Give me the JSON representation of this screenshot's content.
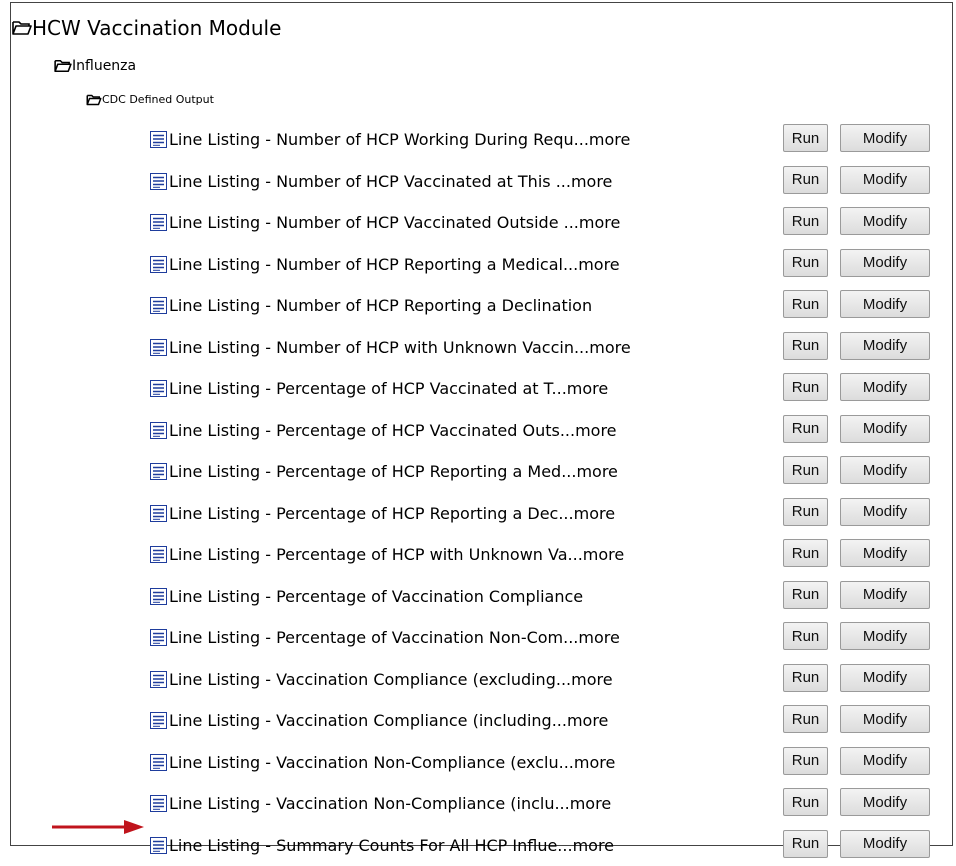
{
  "tree": {
    "module_label": "HCW Vaccination Module",
    "subfolder_label": "Influenza",
    "output_folder_label": "CDC Defined Output"
  },
  "reports": [
    {
      "title": "Line Listing - Number of HCP Working During Requ...",
      "more": "more",
      "run_label": "Run",
      "modify_label": "Modify"
    },
    {
      "title": "Line Listing - Number of HCP Vaccinated at This ...",
      "more": "more",
      "run_label": "Run",
      "modify_label": "Modify"
    },
    {
      "title": "Line Listing - Number of HCP Vaccinated Outside ...",
      "more": "more",
      "run_label": "Run",
      "modify_label": "Modify"
    },
    {
      "title": "Line Listing - Number of HCP Reporting a Medical...",
      "more": "more",
      "run_label": "Run",
      "modify_label": "Modify"
    },
    {
      "title": "Line Listing - Number of HCP Reporting a Declination",
      "more": "",
      "run_label": "Run",
      "modify_label": "Modify"
    },
    {
      "title": "Line Listing - Number of HCP with Unknown Vaccin...",
      "more": "more",
      "run_label": "Run",
      "modify_label": "Modify"
    },
    {
      "title": "Line Listing - Percentage of HCP Vaccinated at T...",
      "more": "more",
      "run_label": "Run",
      "modify_label": "Modify"
    },
    {
      "title": "Line Listing - Percentage of HCP Vaccinated Outs...",
      "more": "more",
      "run_label": "Run",
      "modify_label": "Modify"
    },
    {
      "title": "Line Listing - Percentage of HCP Reporting a Med...",
      "more": "more",
      "run_label": "Run",
      "modify_label": "Modify"
    },
    {
      "title": "Line Listing - Percentage of HCP Reporting a Dec...",
      "more": "more",
      "run_label": "Run",
      "modify_label": "Modify"
    },
    {
      "title": "Line Listing - Percentage of HCP with Unknown Va...",
      "more": "more",
      "run_label": "Run",
      "modify_label": "Modify"
    },
    {
      "title": "Line Listing - Percentage of Vaccination Compliance",
      "more": "",
      "run_label": "Run",
      "modify_label": "Modify"
    },
    {
      "title": "Line Listing - Percentage of Vaccination Non-Com...",
      "more": "more",
      "run_label": "Run",
      "modify_label": "Modify"
    },
    {
      "title": "Line Listing - Vaccination Compliance (excluding...",
      "more": "more",
      "run_label": "Run",
      "modify_label": "Modify"
    },
    {
      "title": "Line Listing - Vaccination Compliance (including...",
      "more": "more",
      "run_label": "Run",
      "modify_label": "Modify"
    },
    {
      "title": "Line Listing - Vaccination Non-Compliance (exclu...",
      "more": "more",
      "run_label": "Run",
      "modify_label": "Modify"
    },
    {
      "title": "Line Listing - Vaccination Non-Compliance (inclu...",
      "more": "more",
      "run_label": "Run",
      "modify_label": "Modify"
    },
    {
      "title": "Line Listing - Summary Counts For All HCP Influe...",
      "more": "more",
      "run_label": "Run",
      "modify_label": "Modify"
    }
  ],
  "icons": {
    "folder": "open-folder-icon",
    "report": "report-document-icon",
    "pointer": "red-arrow-icon"
  },
  "colors": {
    "arrow": "#c0141c",
    "icon_blue": "#1e3c9c",
    "button_border": "#9a9a9a"
  }
}
